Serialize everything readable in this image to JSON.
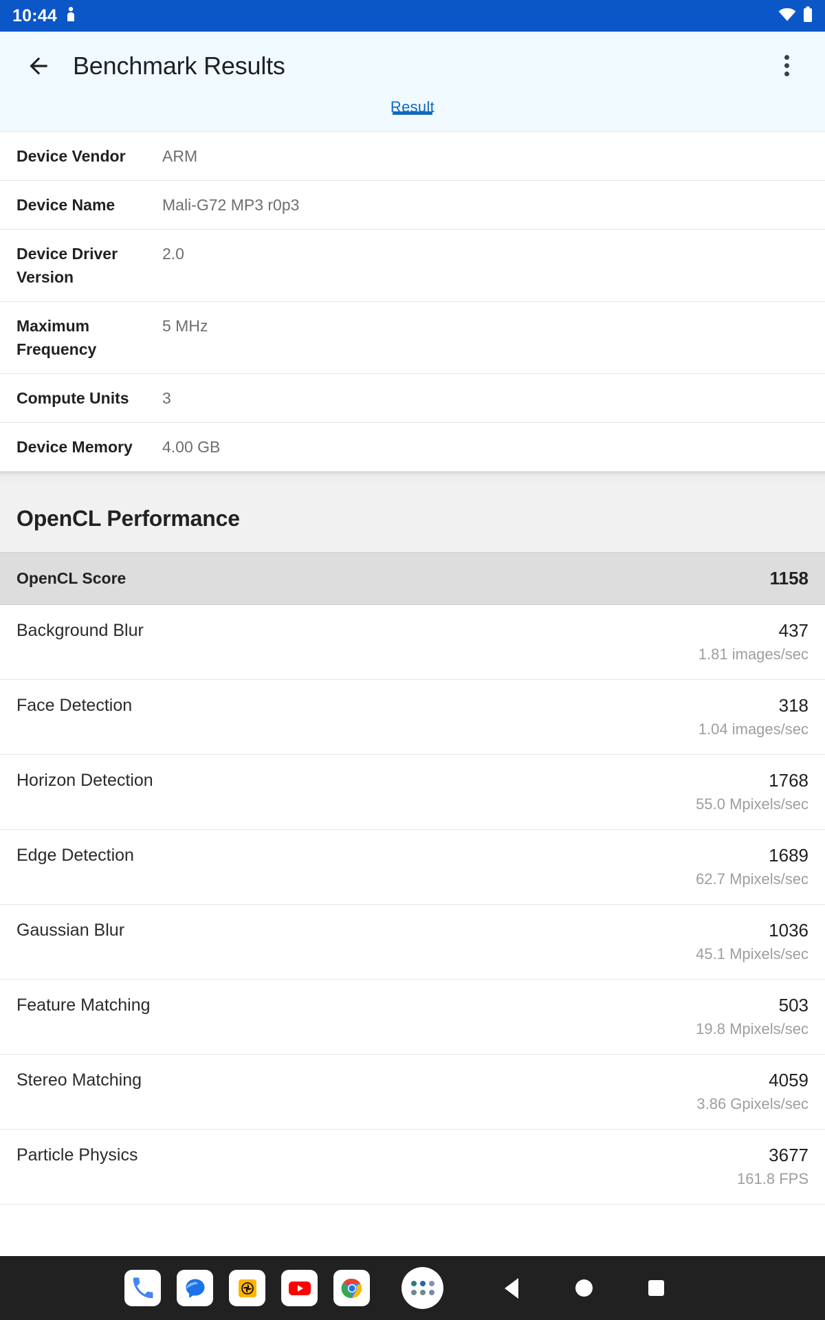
{
  "status_bar": {
    "clock": "10:44",
    "left_icons": [
      "person-pin-icon"
    ],
    "right_icons": [
      "wifi-icon",
      "battery-icon"
    ],
    "background_color": "#0B57C7"
  },
  "app_bar": {
    "back_icon": "arrow-back-icon",
    "title": "Benchmark Results",
    "overflow_icon": "more-vertical-icon",
    "background_color": "#F1FAFE"
  },
  "tabs": {
    "items": [
      {
        "label": "Result",
        "selected": true
      }
    ],
    "accent_color": "#1268C3"
  },
  "device_info": {
    "rows": [
      {
        "key": "Device Vendor",
        "value": "ARM"
      },
      {
        "key": "Device Name",
        "value": "Mali-G72 MP3 r0p3"
      },
      {
        "key": "Device Driver Version",
        "value": "2.0"
      },
      {
        "key": "Maximum Frequency",
        "value": "5 MHz"
      },
      {
        "key": "Compute Units",
        "value": "3"
      },
      {
        "key": "Device Memory",
        "value": "4.00 GB"
      }
    ]
  },
  "performance": {
    "section_title": "OpenCL Performance",
    "score_label": "OpenCL Score",
    "score_value": "1158",
    "benchmarks": [
      {
        "name": "Background Blur",
        "score": "437",
        "unit": "1.81 images/sec"
      },
      {
        "name": "Face Detection",
        "score": "318",
        "unit": "1.04 images/sec"
      },
      {
        "name": "Horizon Detection",
        "score": "1768",
        "unit": "55.0 Mpixels/sec"
      },
      {
        "name": "Edge Detection",
        "score": "1689",
        "unit": "62.7 Mpixels/sec"
      },
      {
        "name": "Gaussian Blur",
        "score": "1036",
        "unit": "45.1 Mpixels/sec"
      },
      {
        "name": "Feature Matching",
        "score": "503",
        "unit": "19.8 Mpixels/sec"
      },
      {
        "name": "Stereo Matching",
        "score": "4059",
        "unit": "3.86 Gpixels/sec"
      },
      {
        "name": "Particle Physics",
        "score": "3677",
        "unit": "161.8 FPS"
      }
    ]
  },
  "dock": {
    "background_color": "#212121",
    "apps": [
      {
        "name": "phone-app-icon"
      },
      {
        "name": "messages-app-icon"
      },
      {
        "name": "camera-app-icon"
      },
      {
        "name": "youtube-app-icon"
      },
      {
        "name": "chrome-app-icon"
      }
    ],
    "drawer": {
      "name": "app-drawer-icon"
    },
    "nav": [
      {
        "name": "nav-back-button"
      },
      {
        "name": "nav-home-button"
      },
      {
        "name": "nav-recents-button"
      }
    ]
  }
}
